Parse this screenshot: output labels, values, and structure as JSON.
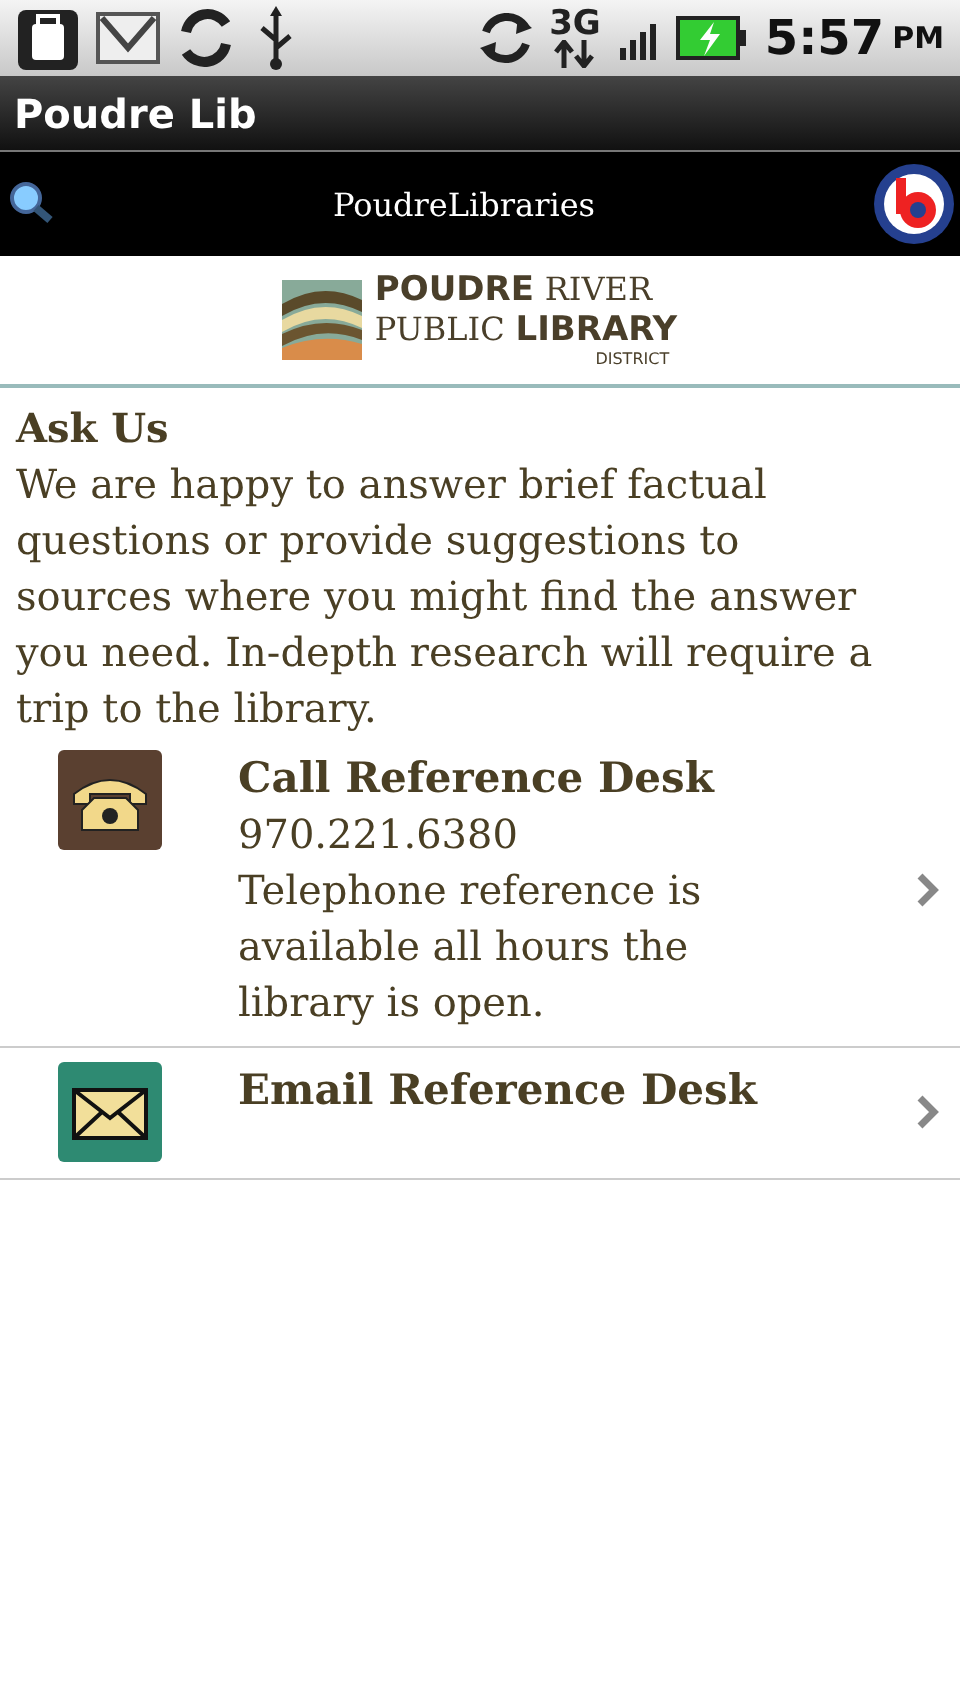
{
  "status_bar": {
    "network": "3G",
    "time": "5:57",
    "ampm": "PM"
  },
  "window": {
    "title": "Poudre Lib"
  },
  "toolbar": {
    "title": "PoudreLibraries"
  },
  "logo": {
    "line1_bold": "POUDRE",
    "line1": "RIVER",
    "line2": "PUBLIC",
    "line2_bold": "LIBRARY",
    "line3": "DISTRICT"
  },
  "section": {
    "heading": "Ask Us",
    "text": "We are happy to answer brief factual questions or provide suggestions to sources where you might find the answer you need. In-depth research will require a trip to the library."
  },
  "items": [
    {
      "kind": "phone",
      "title": "Call Reference Desk",
      "lines": [
        "970.221.6380",
        "Telephone reference is available all hours the library is open."
      ]
    },
    {
      "kind": "email",
      "title": "Email Reference Desk"
    }
  ]
}
